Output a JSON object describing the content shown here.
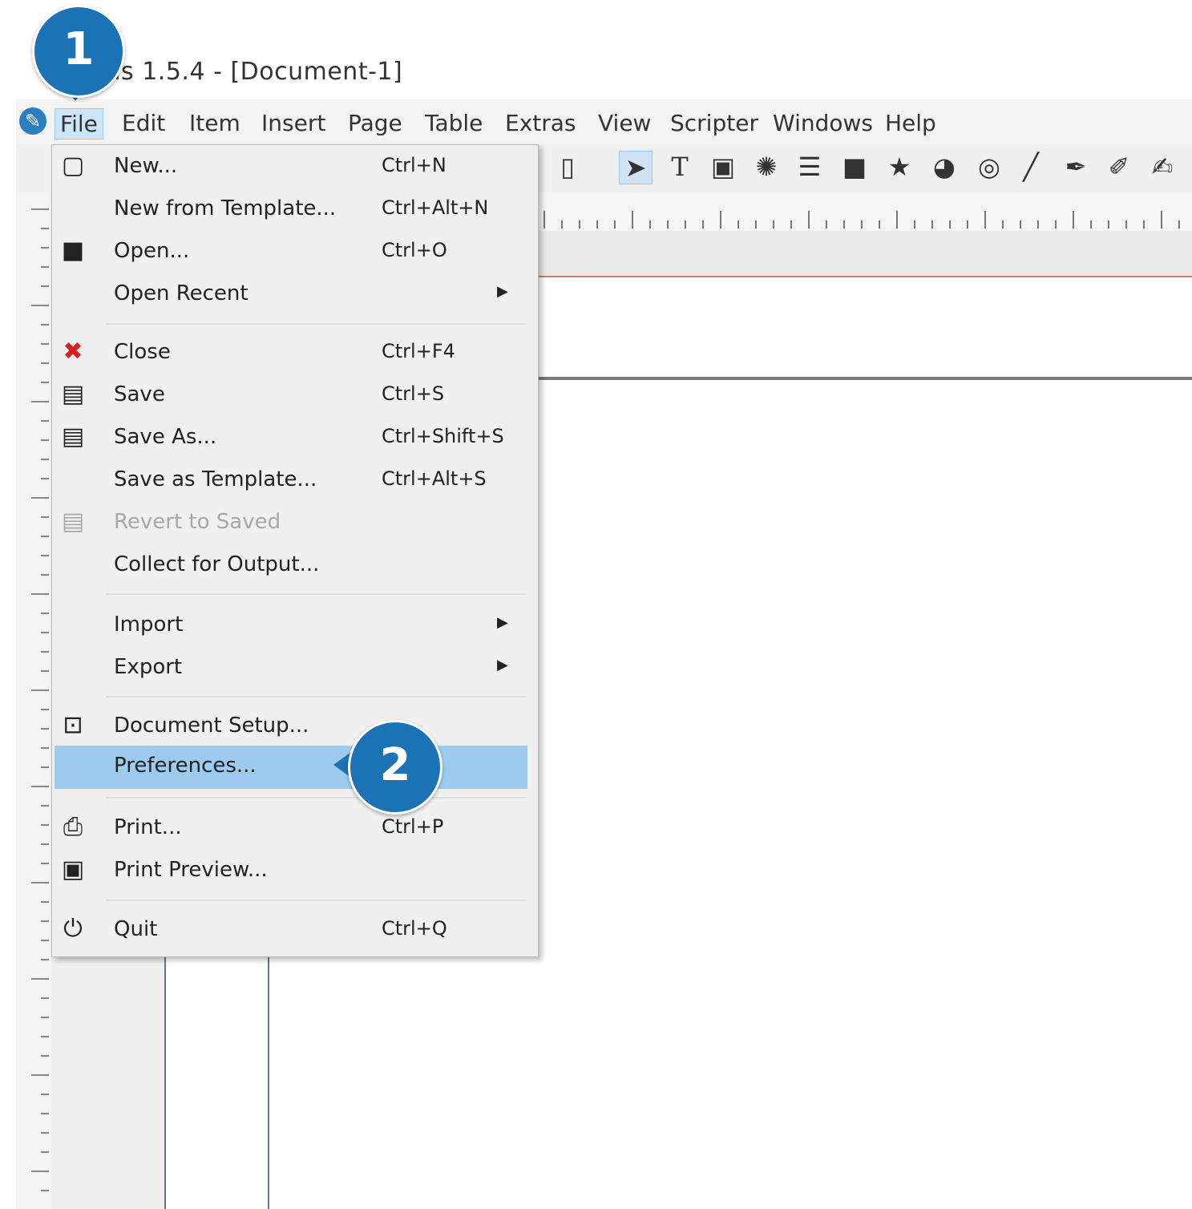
{
  "window": {
    "title": "bus 1.5.4 - [Document-1]",
    "logo_icon": "scribus-logo-icon"
  },
  "menubar": {
    "items": [
      "File",
      "Edit",
      "Item",
      "Insert",
      "Page",
      "Table",
      "Extras",
      "View",
      "Scripter",
      "Windows",
      "Help"
    ]
  },
  "toolbar": {
    "icons": [
      "clipboard-icon",
      "select-arrow-icon",
      "text-frame-icon",
      "image-frame-icon",
      "render-frame-icon",
      "table-icon",
      "shape-icon",
      "polygon-star-icon",
      "arc-icon",
      "spiral-icon",
      "line-icon",
      "bezier-icon",
      "freehand-icon",
      "calligraphic-icon"
    ]
  },
  "file_menu": {
    "items": [
      {
        "label": "New...",
        "shortcut": "Ctrl+N",
        "icon": "new-document-icon"
      },
      {
        "label": "New from Template...",
        "shortcut": "Ctrl+Alt+N",
        "icon": ""
      },
      {
        "label": "Open...",
        "shortcut": "Ctrl+O",
        "icon": "folder-icon"
      },
      {
        "label": "Open Recent",
        "shortcut": "",
        "icon": "",
        "submenu": true
      },
      {
        "label": "Close",
        "shortcut": "Ctrl+F4",
        "icon": "close-icon"
      },
      {
        "label": "Save",
        "shortcut": "Ctrl+S",
        "icon": "save-icon"
      },
      {
        "label": "Save As...",
        "shortcut": "Ctrl+Shift+S",
        "icon": "save-as-icon"
      },
      {
        "label": "Save as Template...",
        "shortcut": "Ctrl+Alt+S",
        "icon": ""
      },
      {
        "label": "Revert to Saved",
        "shortcut": "",
        "icon": "revert-icon",
        "disabled": true
      },
      {
        "label": "Collect for Output...",
        "shortcut": "",
        "icon": ""
      },
      {
        "label": "Import",
        "shortcut": "",
        "icon": "",
        "submenu": true
      },
      {
        "label": "Export",
        "shortcut": "",
        "icon": "",
        "submenu": true
      },
      {
        "label": "Document Setup...",
        "shortcut": "",
        "icon": "document-setup-icon"
      },
      {
        "label": "Preferences...",
        "shortcut": "",
        "icon": "",
        "highlighted": true
      },
      {
        "label": "Print...",
        "shortcut": "Ctrl+P",
        "icon": "printer-icon"
      },
      {
        "label": "Print Preview...",
        "shortcut": "",
        "icon": "print-preview-icon"
      },
      {
        "label": "Quit",
        "shortcut": "Ctrl+Q",
        "icon": "power-icon"
      }
    ]
  },
  "callouts": {
    "step1": "1",
    "step2": "2"
  },
  "colors": {
    "callout": "#1b73b5",
    "highlight": "#9ccbee",
    "menu_bg": "#f0f0f0"
  }
}
